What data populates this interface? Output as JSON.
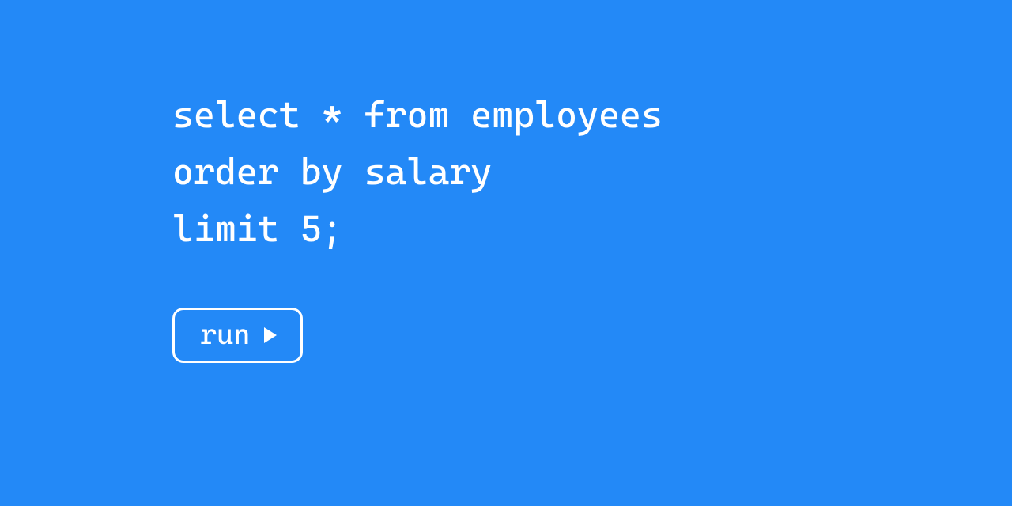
{
  "query": {
    "lines": [
      "select * from employees",
      "order by salary",
      "limit 5;"
    ]
  },
  "actions": {
    "run_label": "run"
  },
  "icons": {
    "play": "play-icon"
  },
  "colors": {
    "background": "#2389f7",
    "foreground": "#ffffff"
  }
}
